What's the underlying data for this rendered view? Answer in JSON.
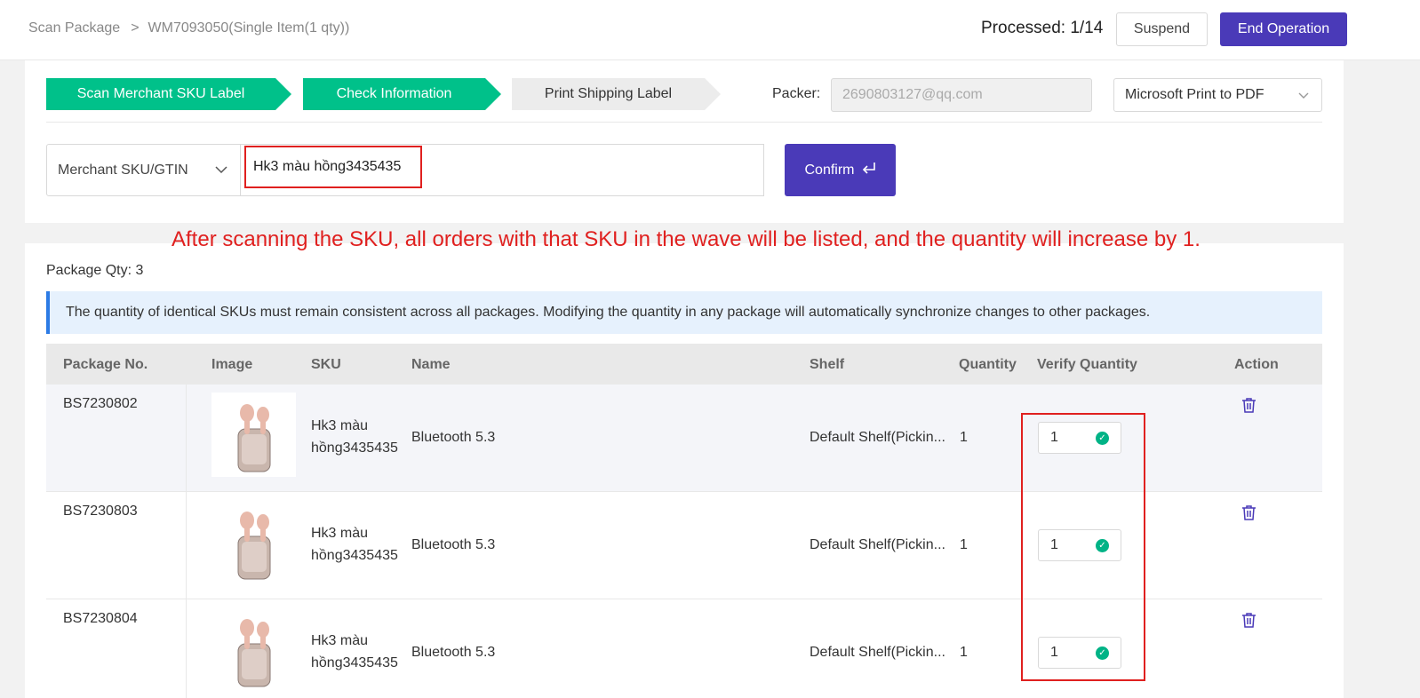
{
  "header": {
    "breadcrumb_root": "Scan Package",
    "breadcrumb_sep": ">",
    "breadcrumb_current": "WM7093050(Single Item(1 qty))",
    "processed": "Processed: 1/14",
    "suspend_label": "Suspend",
    "end_label": "End Operation"
  },
  "steps": [
    {
      "label": "Scan Merchant SKU Label",
      "state": "done"
    },
    {
      "label": "Check Information",
      "state": "active"
    },
    {
      "label": "Print Shipping Label",
      "state": "pending"
    }
  ],
  "packer": {
    "label": "Packer:",
    "value": "2690803127@qq.com"
  },
  "printer": {
    "selected": "Microsoft Print to PDF"
  },
  "scan": {
    "type_selected": "Merchant SKU/GTIN",
    "value": "Hk3 màu hồng3435435",
    "confirm_label": "Confirm"
  },
  "annotation": "After scanning the SKU, all orders with that SKU in the wave will be listed, and the quantity will increase by 1.",
  "package_qty": "Package Qty: 3",
  "notice": "The quantity of identical SKUs must remain consistent across all packages. Modifying the quantity in any package will automatically synchronize changes to other packages.",
  "table": {
    "headers": [
      "Package No.",
      "Image",
      "SKU",
      "Name",
      "Shelf",
      "Quantity",
      "Verify Quantity",
      "Action"
    ],
    "rows": [
      {
        "package_no": "BS7230802",
        "sku_line1": "Hk3 màu",
        "sku_line2": "hồng3435435",
        "name": "Bluetooth 5.3",
        "shelf": "Default Shelf(Pickin...",
        "quantity": "1",
        "verify_quantity": "1"
      },
      {
        "package_no": "BS7230803",
        "sku_line1": "Hk3 màu",
        "sku_line2": "hồng3435435",
        "name": "Bluetooth 5.3",
        "shelf": "Default Shelf(Pickin...",
        "quantity": "1",
        "verify_quantity": "1"
      },
      {
        "package_no": "BS7230804",
        "sku_line1": "Hk3 màu",
        "sku_line2": "hồng3435435",
        "name": "Bluetooth 5.3",
        "shelf": "Default Shelf(Pickin...",
        "quantity": "1",
        "verify_quantity": "1"
      }
    ]
  },
  "colors": {
    "accent": "#4a3ab8",
    "step_active": "#00c18a",
    "highlight": "#e0201f",
    "check": "#00b386"
  }
}
